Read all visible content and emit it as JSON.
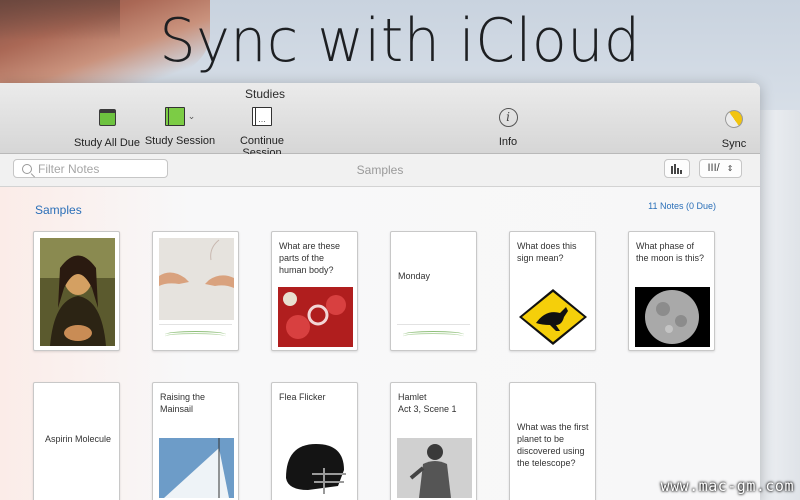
{
  "headline": "Sync with iCloud",
  "window": {
    "title": "Studies",
    "toolbar": {
      "study_all_due": "Study All Due",
      "study_session": "Study Session",
      "continue_session": "Continue Session",
      "info": "Info",
      "sync": "Sync"
    },
    "filterbar": {
      "search_placeholder": "Filter Notes",
      "deck_name": "Samples",
      "view_button": "III/"
    },
    "section": {
      "title": "Samples",
      "count": "11 Notes (0 Due)"
    },
    "cards_row1": [
      {
        "text": "",
        "image": "mona-lisa"
      },
      {
        "text": "",
        "image": "creation-of-adam"
      },
      {
        "text": "What are these parts of the human body?",
        "image": "blood-cells"
      },
      {
        "text": "Monday",
        "image": ""
      },
      {
        "text": "What does this sign mean?",
        "image": "kangaroo-sign"
      },
      {
        "text": "What phase of the moon is this?",
        "image": "full-moon"
      }
    ],
    "cards_row2": [
      {
        "text": "Aspirin Molecule",
        "image": ""
      },
      {
        "text": "Raising the Mainsail",
        "image": "sail"
      },
      {
        "text": "Flea Flicker",
        "image": "football-helmet"
      },
      {
        "text": "Hamlet\nAct 3, Scene 1",
        "image": "statue"
      },
      {
        "text": "What was the first planet to be discovered using the telescope?",
        "image": ""
      }
    ]
  },
  "watermark": "www.mac-gm.com"
}
